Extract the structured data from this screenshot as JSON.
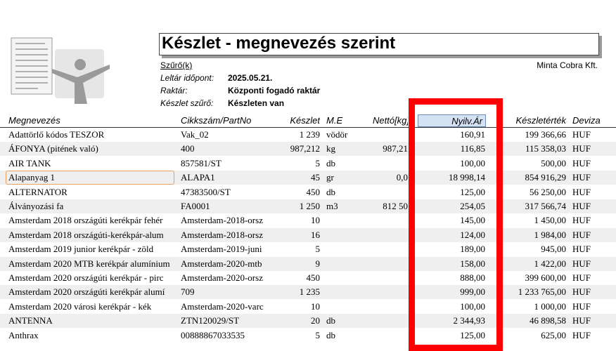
{
  "header": {
    "title": "Készlet - megnevezés szerint",
    "filter_link": "Szűrő(k)",
    "company": "Minta Cobra Kft."
  },
  "meta": [
    {
      "label": "Leltár időpont:",
      "value": "2025.05.21."
    },
    {
      "label": "Raktár:",
      "value": "Központi fogadó raktár"
    },
    {
      "label": "Készlet szűrő:",
      "value": "Készleten van"
    }
  ],
  "columns": {
    "name": "Megnevezés",
    "sku": "Cikkszám/PartNo",
    "stock": "Készlet",
    "unit": "M.E",
    "net": "Nettó[kg]",
    "price": "Nyilv.Ár",
    "value": "Készletérték",
    "currency": "Deviza"
  },
  "rows": [
    {
      "name": "Adattörlő kódos TESZOR",
      "sku": "Vak_02",
      "stock": "1 239",
      "unit": "vödör",
      "net": "",
      "price": "160,91",
      "value": "199 366,66",
      "currency": "HUF"
    },
    {
      "name": "ÁFONYA (pitének való)",
      "sku": "400",
      "stock": "987,212",
      "unit": "kg",
      "net": "987,21",
      "price": "116,85",
      "value": "115 358,03",
      "currency": "HUF"
    },
    {
      "name": "AIR TANK",
      "sku": "857581/ST",
      "stock": "5",
      "unit": "db",
      "net": "",
      "price": "100,00",
      "value": "500,00",
      "currency": "HUF"
    },
    {
      "name": "Alapanyag 1",
      "sku": "ALAPA1",
      "stock": "45",
      "unit": "gr",
      "net": "0,0",
      "price": "18 998,14",
      "value": "854 916,29",
      "currency": "HUF"
    },
    {
      "name": "ALTERNATOR",
      "sku": "47383500/ST",
      "stock": "450",
      "unit": "db",
      "net": "",
      "price": "125,00",
      "value": "56 250,00",
      "currency": "HUF"
    },
    {
      "name": "Álványozási fa",
      "sku": "FA0001",
      "stock": "1 250",
      "unit": "m3",
      "net": "812 50",
      "price": "254,05",
      "value": "317 566,74",
      "currency": "HUF"
    },
    {
      "name": "Amsterdam 2018 országúti kerékpár fehér",
      "sku": "Amsterdam-2018-orsz",
      "stock": "10",
      "unit": "",
      "net": "",
      "price": "145,00",
      "value": "1 450,00",
      "currency": "HUF"
    },
    {
      "name": "Amsterdam 2018 országúti-kerékpár-alum",
      "sku": "Amsterdam-2018-orsz",
      "stock": "16",
      "unit": "",
      "net": "",
      "price": "124,00",
      "value": "1 984,00",
      "currency": "HUF"
    },
    {
      "name": "Amsterdam 2019 junior kerékpár - zöld",
      "sku": "Amsterdam-2019-juni",
      "stock": "5",
      "unit": "",
      "net": "",
      "price": "189,00",
      "value": "945,00",
      "currency": "HUF"
    },
    {
      "name": "Amsterdam 2020 MTB kerékpár alumínium",
      "sku": "Amsterdam-2020-mtb",
      "stock": "9",
      "unit": "",
      "net": "",
      "price": "158,00",
      "value": "1 422,00",
      "currency": "HUF"
    },
    {
      "name": "Amsterdam 2020 országúti kerékpár - pirc",
      "sku": "Amsterdam-2020-orsz",
      "stock": "450",
      "unit": "",
      "net": "",
      "price": "888,00",
      "value": "399 600,00",
      "currency": "HUF"
    },
    {
      "name": "Amsterdam 2020 országúti kerékpár alumí",
      "sku": "709",
      "stock": "1 235",
      "unit": "",
      "net": "",
      "price": "999,00",
      "value": "1 233 765,00",
      "currency": "HUF"
    },
    {
      "name": "Amsterdam 2020 városi kerékpár - kék",
      "sku": "Amsterdam-2020-varc",
      "stock": "10",
      "unit": "",
      "net": "",
      "price": "100,00",
      "value": "1 000,00",
      "currency": "HUF"
    },
    {
      "name": "ANTENNA",
      "sku": "ZTN120029/ST",
      "stock": "20",
      "unit": "db",
      "net": "",
      "price": "2 344,93",
      "value": "46 898,58",
      "currency": "HUF"
    },
    {
      "name": "Anthrax",
      "sku": "00888867033535",
      "stock": "5",
      "unit": "db",
      "net": "",
      "price": "125,00",
      "value": "625,00",
      "currency": "HUF"
    }
  ],
  "colors": {
    "highlight": "#ff0000",
    "alt_row": "#efefef",
    "selected_header": "#d4e2f4"
  }
}
